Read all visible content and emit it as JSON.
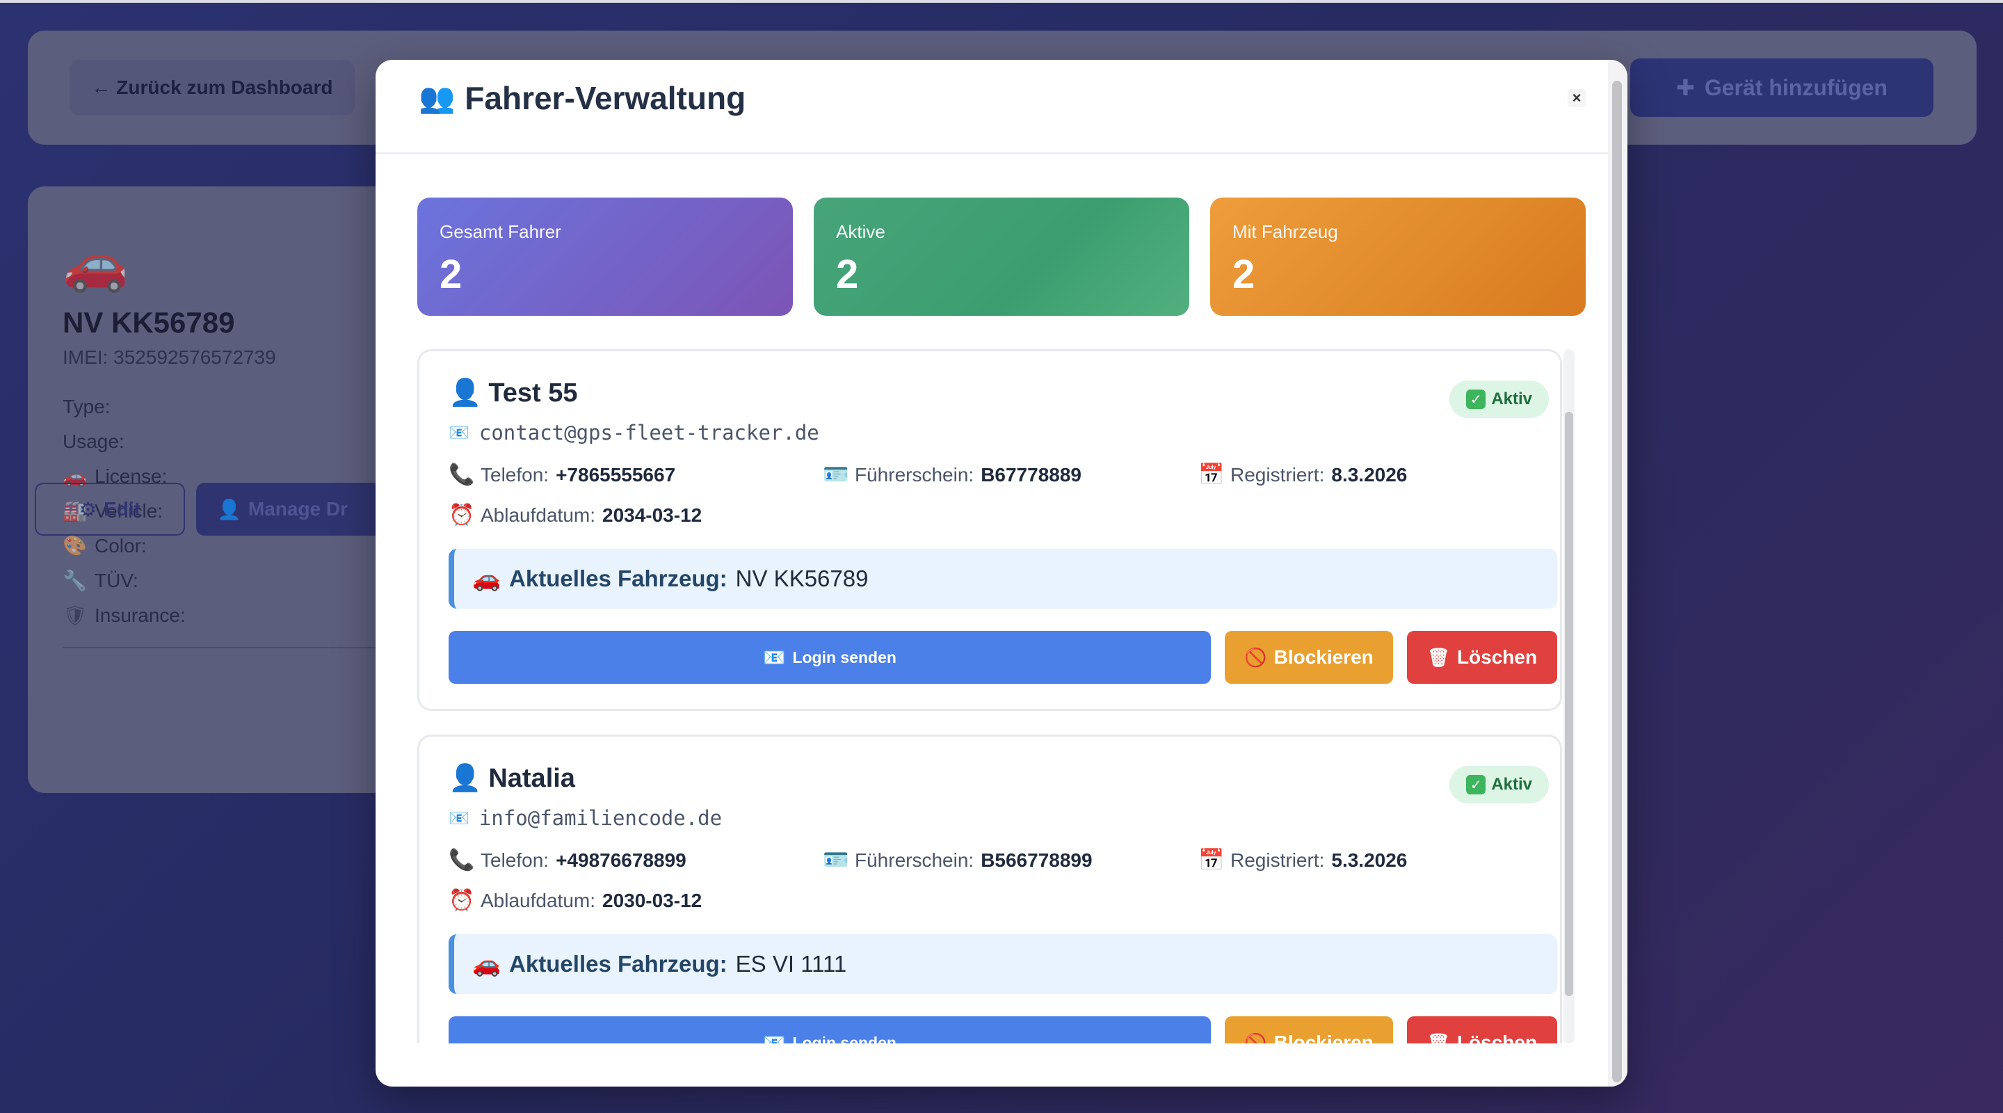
{
  "background": {
    "back_button": "← Zurück zum Dashboard",
    "add_device_button": "Gerät hinzufügen",
    "add_device_icon": "plus-icon",
    "device": {
      "plate": "NV KK56789",
      "imei": "IMEI: 352592576572739",
      "fields": [
        {
          "icon": "type",
          "label": "Type:"
        },
        {
          "icon": "usage",
          "label": "Usage:"
        },
        {
          "icon": "car-icon",
          "label": "License:"
        },
        {
          "icon": "factory-icon",
          "label": "Vehicle:"
        },
        {
          "icon": "palette-icon",
          "label": "Color:"
        },
        {
          "icon": "wrench-icon",
          "label": "TÜV:"
        },
        {
          "icon": "shield-icon",
          "label": "Insurance:"
        }
      ],
      "edit_button": "Edit",
      "manage_button": "Manage Dr"
    }
  },
  "modal": {
    "title": "Fahrer-Verwaltung",
    "close": "×",
    "stats": {
      "total_label": "Gesamt Fahrer",
      "total_value": "2",
      "active_label": "Aktive",
      "active_value": "2",
      "vehicle_label": "Mit Fahrzeug",
      "vehicle_value": "2"
    },
    "drivers": [
      {
        "name": "Test 55",
        "status": "Aktiv",
        "email": "contact@gps-fleet-tracker.de",
        "phone_label": "Telefon:",
        "phone": "+7865555667",
        "license_label": "Führerschein:",
        "license": "B67778889",
        "registered_label": "Registriert:",
        "registered": "8.3.2026",
        "expiry_label": "Ablaufdatum:",
        "expiry": "2034-03-12",
        "vehicle_label": "Aktuelles Fahrzeug:",
        "vehicle": "NV KK56789",
        "login_button": "Login senden",
        "block_button": "Blockieren",
        "delete_button": "Löschen"
      },
      {
        "name": "Natalia",
        "status": "Aktiv",
        "email": "info@familiencode.de",
        "phone_label": "Telefon:",
        "phone": "+49876678899",
        "license_label": "Führerschein:",
        "license": "B566778899",
        "registered_label": "Registriert:",
        "registered": "5.3.2026",
        "expiry_label": "Ablaufdatum:",
        "expiry": "2030-03-12",
        "vehicle_label": "Aktuelles Fahrzeug:",
        "vehicle": "ES VI 1111",
        "login_button": "Login senden",
        "block_button": "Blockieren",
        "delete_button": "Löschen"
      }
    ]
  },
  "colors": {
    "stat_total": "#6b74dc",
    "stat_active": "#47a47a",
    "stat_vehicle": "#ee9c3c",
    "login_button": "#4a80e8",
    "block_button": "#e9a030",
    "delete_button": "#e0413e",
    "status_badge": "#dcf5e4"
  }
}
